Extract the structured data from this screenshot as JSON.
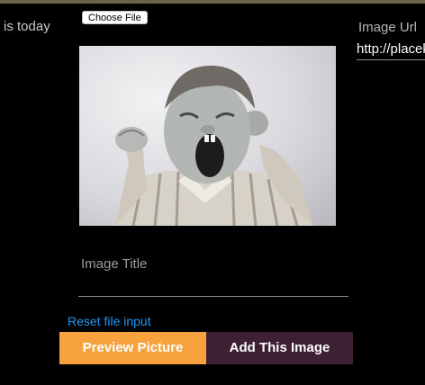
{
  "page": {
    "accent_color": "#6b624a",
    "background_color": "#000000"
  },
  "left_panel": {
    "text": "is today"
  },
  "file_input": {
    "button_label": "Choose File"
  },
  "preview": {
    "image_alt": "black and white photo of a yawning boy stretching his arms"
  },
  "form": {
    "title_label": "Image Title",
    "title_value": "",
    "reset_link_label": "Reset file input",
    "preview_button_label": "Preview Picture",
    "preview_button_color": "#f7a23e",
    "add_button_label": "Add This Image",
    "add_button_color": "#3d2033",
    "link_color": "#2196f3"
  },
  "url_panel": {
    "label": "Image Url",
    "value": "http://placekitten.com"
  }
}
